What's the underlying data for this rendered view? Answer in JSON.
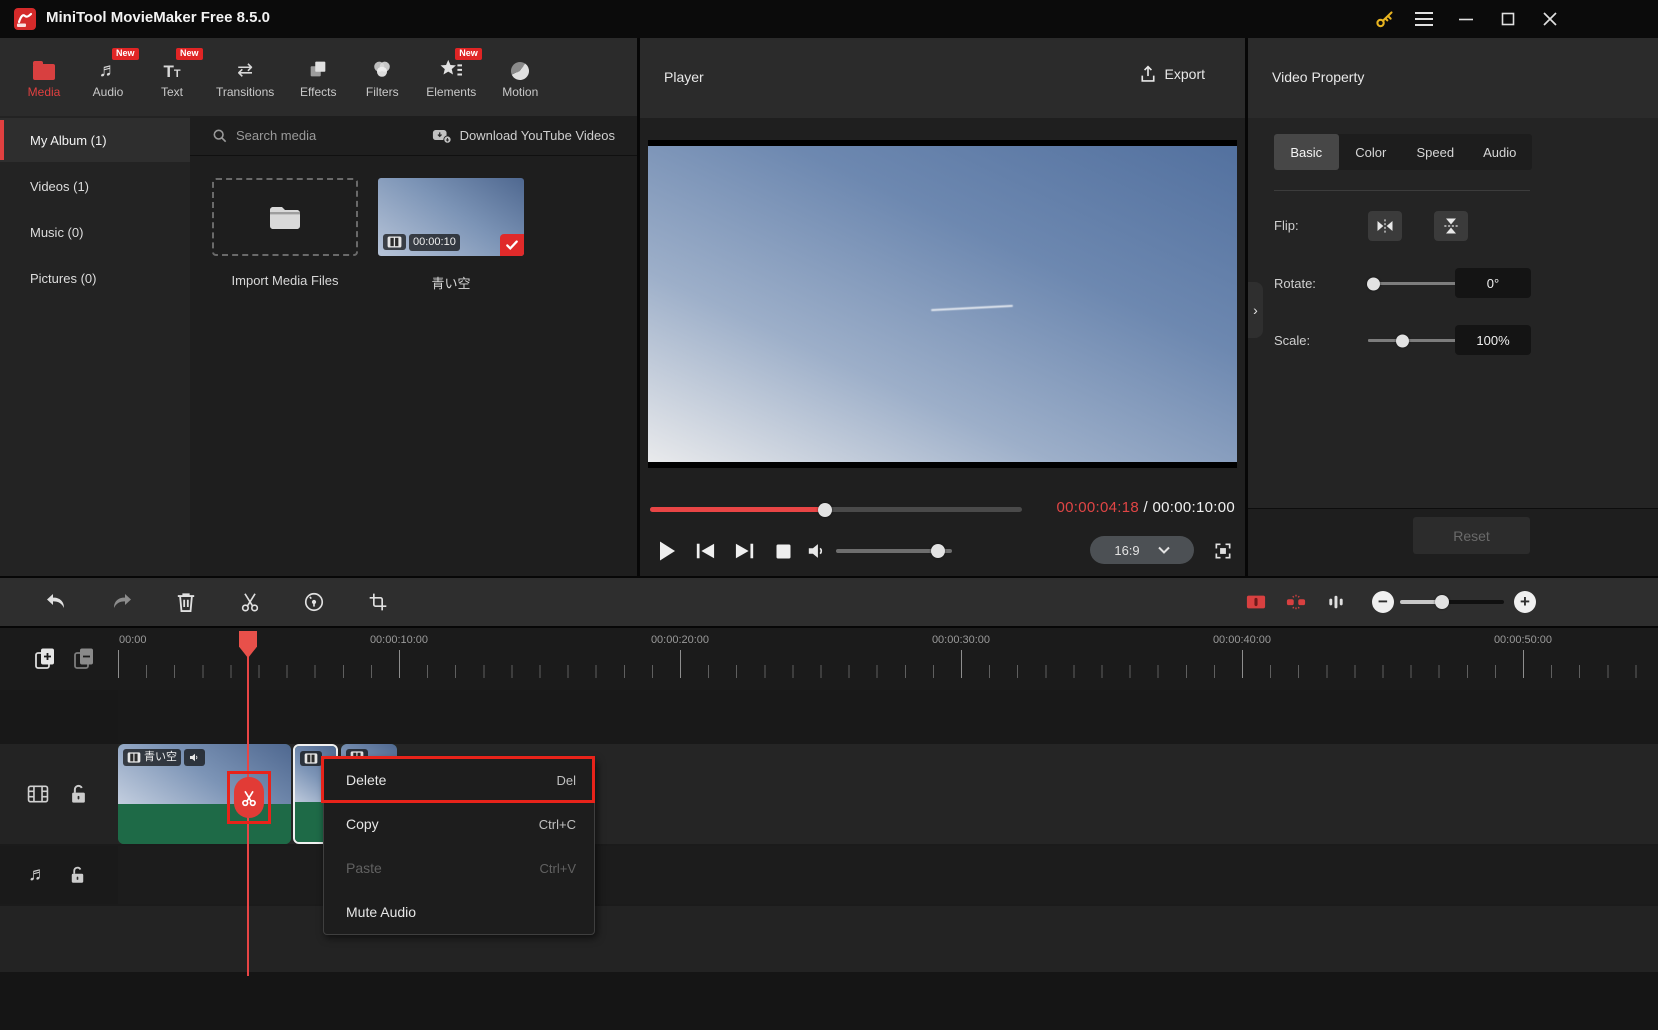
{
  "titlebar": {
    "title": "MiniTool MovieMaker Free 8.5.0"
  },
  "topnav": {
    "items": [
      {
        "label": "Media",
        "badge": "",
        "active": true
      },
      {
        "label": "Audio",
        "badge": "New",
        "active": false
      },
      {
        "label": "Text",
        "badge": "New",
        "active": false
      },
      {
        "label": "Transitions",
        "badge": "",
        "active": false
      },
      {
        "label": "Effects",
        "badge": "",
        "active": false
      },
      {
        "label": "Filters",
        "badge": "",
        "active": false
      },
      {
        "label": "Elements",
        "badge": "New",
        "active": false
      },
      {
        "label": "Motion",
        "badge": "",
        "active": false
      }
    ]
  },
  "sidebar": {
    "items": [
      {
        "label": "My Album (1)",
        "active": true
      },
      {
        "label": "Videos (1)",
        "active": false
      },
      {
        "label": "Music (0)",
        "active": false
      },
      {
        "label": "Pictures (0)",
        "active": false
      }
    ]
  },
  "media": {
    "search_label": "Search media",
    "download_label": "Download YouTube Videos",
    "import_label": "Import Media Files",
    "clip_name": "青い空",
    "clip_duration": "00:00:10"
  },
  "player": {
    "title": "Player",
    "export_label": "Export",
    "current_time": "00:00:04:18",
    "time_separator": " / ",
    "total_time": "00:00:10:00",
    "aspect_ratio": "16:9",
    "progress_pct": 47,
    "volume_pct": 88
  },
  "properties": {
    "title": "Video Property",
    "tabs": [
      {
        "label": "Basic",
        "active": true
      },
      {
        "label": "Color",
        "active": false
      },
      {
        "label": "Speed",
        "active": false
      },
      {
        "label": "Audio",
        "active": false
      }
    ],
    "flip_label": "Flip:",
    "rotate_label": "Rotate:",
    "rotate_value": "0°",
    "rotate_pct": 4,
    "scale_label": "Scale:",
    "scale_value": "100%",
    "scale_pct": 26,
    "reset_label": "Reset"
  },
  "timeline": {
    "zoom_pct": 40,
    "ruler_labels": [
      "00:00",
      "00:00:10:00",
      "00:00:20:00",
      "00:00:30:00",
      "00:00:40:00",
      "00:00:50:00"
    ],
    "clip_name": "青い空",
    "menu": {
      "items": [
        {
          "label": "Delete",
          "shortcut": "Del"
        },
        {
          "label": "Copy",
          "shortcut": "Ctrl+C"
        },
        {
          "label": "Paste",
          "shortcut": "Ctrl+V"
        },
        {
          "label": "Mute Audio",
          "shortcut": ""
        }
      ]
    }
  },
  "colors": {
    "accent_red": "#e04040",
    "annotation_red": "#e8231a",
    "badge_red": "#e02525",
    "audio_green": "#1e6a47",
    "key_gold": "#e8b420",
    "time_red": "#e04545"
  }
}
